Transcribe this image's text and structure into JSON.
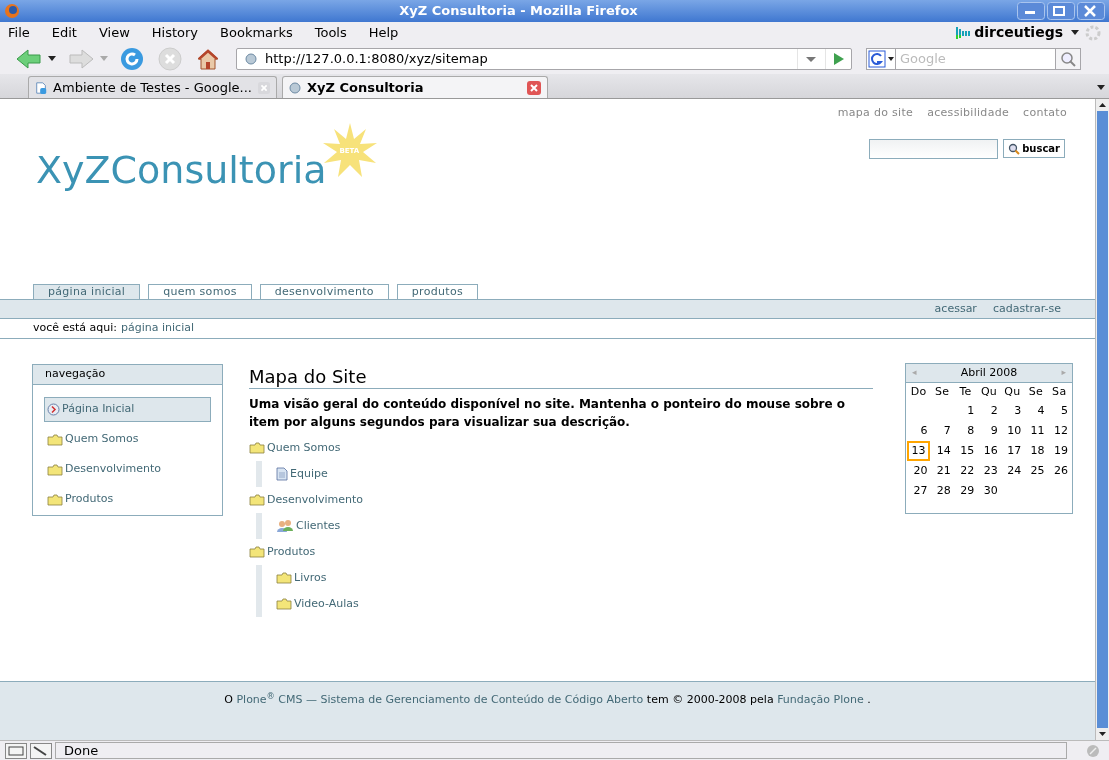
{
  "window": {
    "title": "XyZ Consultoria - Mozilla Firefox"
  },
  "menu": [
    "File",
    "Edit",
    "View",
    "History",
    "Bookmarks",
    "Tools",
    "Help"
  ],
  "profile": {
    "name": "dirceutiegs"
  },
  "address_bar": {
    "value": "http://127.0.0.1:8080/xyz/sitemap"
  },
  "search_bar": {
    "placeholder": "Google"
  },
  "tabs": [
    {
      "label": "Ambiente de Testes - Google...",
      "selected": false
    },
    {
      "label": "XyZ Consultoria",
      "selected": true
    }
  ],
  "page": {
    "site_actions": [
      "mapa do site",
      "acessibilidade",
      "contato"
    ],
    "logo": {
      "text": "XyZConsultoria",
      "badge": "BETA"
    },
    "search_button": "buscar",
    "sections": [
      {
        "label": "página inicial",
        "selected": true
      },
      {
        "label": "quem somos",
        "selected": false
      },
      {
        "label": "desenvolvimento",
        "selected": false
      },
      {
        "label": "produtos",
        "selected": false
      }
    ],
    "user_actions": [
      "acessar",
      "cadastrar-se"
    ],
    "breadcrumb": {
      "label": "você está aqui:",
      "link": "página inicial"
    },
    "navigation": {
      "title": "navegação",
      "items": [
        {
          "label": "Página Inicial",
          "kind": "home",
          "selected": true
        },
        {
          "label": "Quem Somos",
          "kind": "folder",
          "selected": false
        },
        {
          "label": "Desenvolvimento",
          "kind": "folder",
          "selected": false
        },
        {
          "label": "Produtos",
          "kind": "folder",
          "selected": false
        }
      ]
    },
    "title": "Mapa do Site",
    "description": "Uma visão geral do conteúdo disponível no site. Mantenha o ponteiro do mouse sobre o item por alguns segundos para visualizar sua descrição.",
    "sitemap": [
      {
        "label": "Quem Somos",
        "kind": "folder",
        "children": [
          {
            "label": "Equipe",
            "kind": "document"
          }
        ]
      },
      {
        "label": "Desenvolvimento",
        "kind": "folder",
        "children": [
          {
            "label": "Clientes",
            "kind": "group"
          }
        ]
      },
      {
        "label": "Produtos",
        "kind": "folder",
        "children": [
          {
            "label": "Livros",
            "kind": "folder"
          },
          {
            "label": "Video-Aulas",
            "kind": "folder"
          }
        ]
      }
    ],
    "calendar": {
      "prev": "◂",
      "month": "Abril 2008",
      "next": "▸",
      "weekdays": [
        "Do",
        "Se",
        "Te",
        "Qu",
        "Qu",
        "Se",
        "Sa"
      ],
      "weeks": [
        [
          {
            "day": "1",
            "today": false
          },
          {
            "day": "2",
            "today": false
          },
          {
            "day": "3",
            "today": false
          },
          {
            "day": "4",
            "today": false
          },
          {
            "day": "5",
            "today": false
          }
        ],
        [
          {
            "day": "6",
            "today": false
          },
          {
            "day": "7",
            "today": false
          },
          {
            "day": "8",
            "today": false
          },
          {
            "day": "9",
            "today": false
          },
          {
            "day": "10",
            "today": false
          },
          {
            "day": "11",
            "today": false
          },
          {
            "day": "12",
            "today": false
          }
        ],
        [
          {
            "day": "13",
            "today": true
          },
          {
            "day": "14",
            "today": false
          },
          {
            "day": "15",
            "today": false
          },
          {
            "day": "16",
            "today": false
          },
          {
            "day": "17",
            "today": false
          },
          {
            "day": "18",
            "today": false
          },
          {
            "day": "19",
            "today": false
          }
        ],
        [
          {
            "day": "20",
            "today": false
          },
          {
            "day": "21",
            "today": false
          },
          {
            "day": "22",
            "today": false
          },
          {
            "day": "23",
            "today": false
          },
          {
            "day": "24",
            "today": false
          },
          {
            "day": "25",
            "today": false
          },
          {
            "day": "26",
            "today": false
          }
        ],
        [
          {
            "day": "27",
            "today": false
          },
          {
            "day": "28",
            "today": false
          },
          {
            "day": "29",
            "today": false
          },
          {
            "day": "30",
            "today": false
          }
        ]
      ]
    },
    "footer": [
      {
        "kind": "text",
        "text": "O"
      },
      {
        "kind": "link",
        "text": "Plone$^{®}$ CMS — Sistema de Gerenciamento de Conteúdo de Código Aberto"
      },
      {
        "kind": "text",
        "text": "tem © 2000-2008 pela"
      },
      {
        "kind": "link",
        "text": "Fundação Plone"
      },
      {
        "kind": "text",
        "text": "."
      }
    ]
  },
  "status_bar": {
    "text": "Done"
  }
}
